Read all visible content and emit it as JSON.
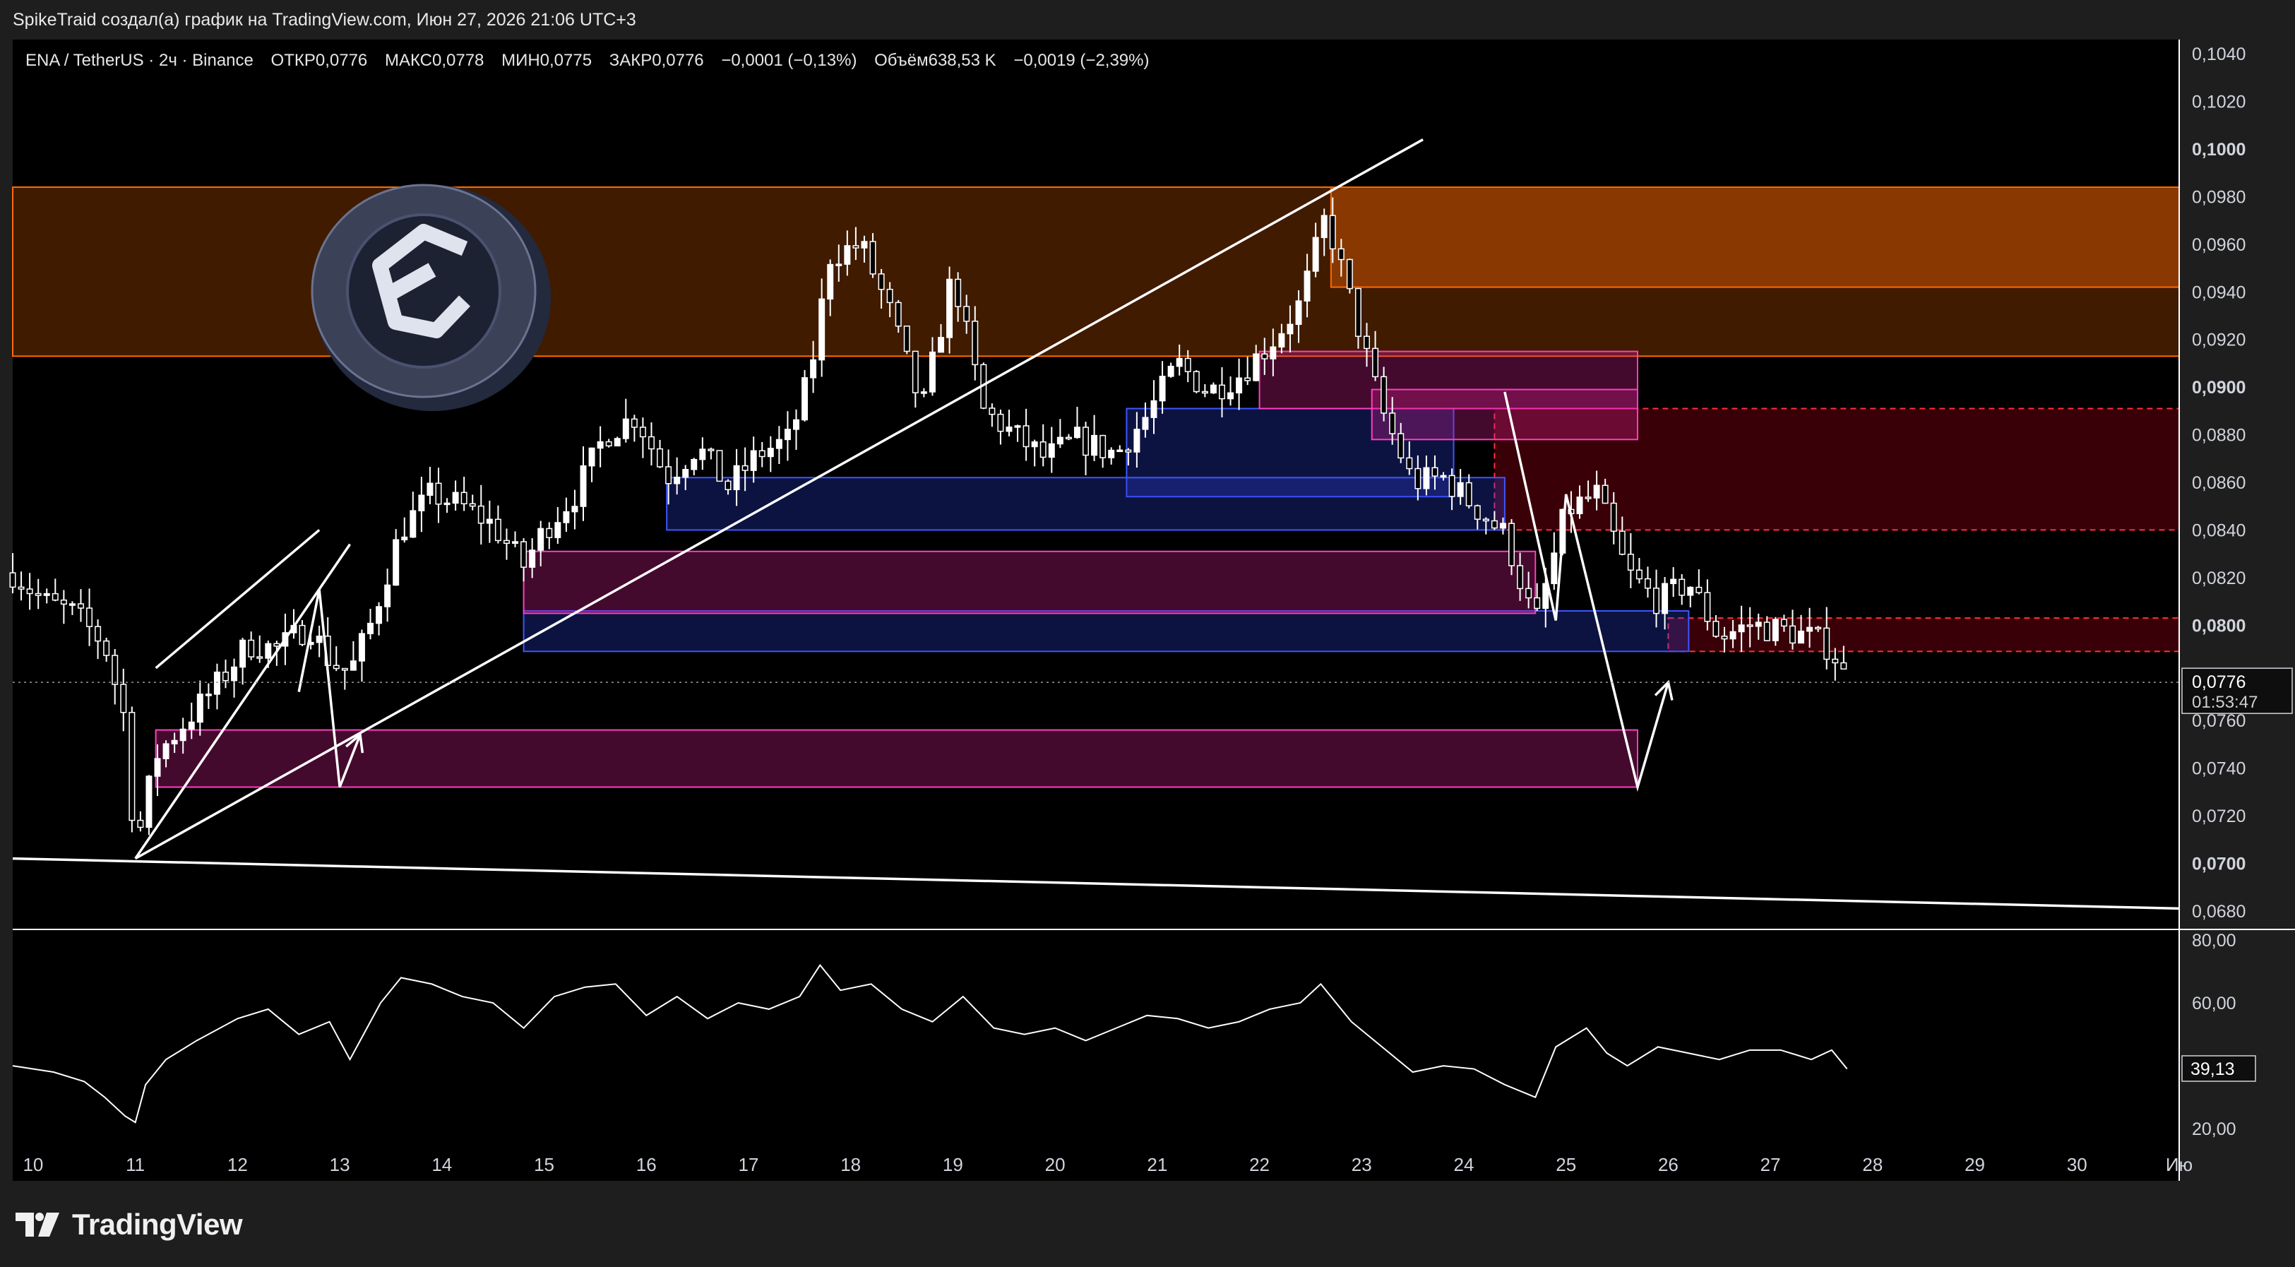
{
  "header": {
    "attribution": "SpikeTraid создал(а) график на TradingView.com, Июн 27, 2026 21:06 UTC+3"
  },
  "legend": {
    "symbol": "ENA / TetherUS · 2ч · Binance",
    "open": "ОТКР0,0776",
    "high": "МАКС0,0778",
    "low": "МИН0,0775",
    "close": "ЗАКР0,0776",
    "change": "−0,0001 (−0,13%)",
    "volume": "Объём638,53 K",
    "change2": "−0,0019 (−2,39%)"
  },
  "price_axis": {
    "labels": [
      "0,1040",
      "0,1020",
      "0,1000",
      "0,0980",
      "0,0960",
      "0,0940",
      "0,0920",
      "0,0900",
      "0,0880",
      "0,0860",
      "0,0840",
      "0,0820",
      "0,0800",
      "0,0780",
      "0,0760",
      "0,0740",
      "0,0720",
      "0,0700",
      "0,0680"
    ],
    "bold_labels": [
      "0,1000",
      "0,0900",
      "0,0800",
      "0,0700"
    ],
    "current_price": "0,0776",
    "countdown": "01:53:47"
  },
  "time_axis": {
    "labels": [
      "10",
      "11",
      "12",
      "13",
      "14",
      "15",
      "16",
      "17",
      "18",
      "19",
      "20",
      "21",
      "22",
      "23",
      "24",
      "25",
      "26",
      "27",
      "28",
      "29",
      "30",
      "Ию"
    ]
  },
  "indicator_axis": {
    "labels": [
      "80,00",
      "60,00",
      "20,00"
    ],
    "current_value": "39,13"
  },
  "footer": {
    "brand": "TradingView"
  },
  "colors": {
    "up_candle": "#ffffff",
    "down_candle": "#000000",
    "supply_zone": "#ff6a00",
    "demand_zone": "#2b3fd6",
    "magenta_zone": "#d21e8c",
    "red_zone": "#c0001a",
    "trendline": "#ffffff"
  },
  "chart_data": {
    "type": "candlestick",
    "symbol": "ENA / TetherUS",
    "interval": "2ч",
    "exchange": "Binance",
    "ylim": [
      0.0674,
      0.1046
    ],
    "x_range_days": [
      9.8,
      31.0
    ],
    "close_path": [
      [
        9.8,
        0.0822
      ],
      [
        10.1,
        0.081
      ],
      [
        10.4,
        0.0805
      ],
      [
        10.7,
        0.0792
      ],
      [
        10.9,
        0.076
      ],
      [
        11.0,
        0.0705
      ],
      [
        11.2,
        0.0745
      ],
      [
        11.5,
        0.076
      ],
      [
        11.8,
        0.0775
      ],
      [
        12.1,
        0.0792
      ],
      [
        12.4,
        0.079
      ],
      [
        12.7,
        0.08
      ],
      [
        12.9,
        0.0785
      ],
      [
        13.1,
        0.078
      ],
      [
        13.3,
        0.08
      ],
      [
        13.6,
        0.084
      ],
      [
        13.9,
        0.0855
      ],
      [
        14.2,
        0.085
      ],
      [
        14.5,
        0.0842
      ],
      [
        14.8,
        0.0825
      ],
      [
        15.0,
        0.084
      ],
      [
        15.3,
        0.0855
      ],
      [
        15.6,
        0.088
      ],
      [
        15.9,
        0.0888
      ],
      [
        16.2,
        0.0862
      ],
      [
        16.5,
        0.0875
      ],
      [
        16.8,
        0.0858
      ],
      [
        17.1,
        0.0872
      ],
      [
        17.4,
        0.0878
      ],
      [
        17.6,
        0.0905
      ],
      [
        17.8,
        0.0955
      ],
      [
        18.1,
        0.096
      ],
      [
        18.4,
        0.093
      ],
      [
        18.7,
        0.089
      ],
      [
        19.0,
        0.0948
      ],
      [
        19.3,
        0.089
      ],
      [
        19.6,
        0.088
      ],
      [
        19.9,
        0.087
      ],
      [
        20.2,
        0.0878
      ],
      [
        20.6,
        0.0872
      ],
      [
        20.9,
        0.0888
      ],
      [
        21.2,
        0.091
      ],
      [
        21.5,
        0.0898
      ],
      [
        21.8,
        0.0905
      ],
      [
        22.1,
        0.0918
      ],
      [
        22.4,
        0.0935
      ],
      [
        22.65,
        0.0972
      ],
      [
        22.9,
        0.0935
      ],
      [
        23.2,
        0.089
      ],
      [
        23.5,
        0.086
      ],
      [
        23.8,
        0.0862
      ],
      [
        24.1,
        0.085
      ],
      [
        24.4,
        0.0838
      ],
      [
        24.7,
        0.08
      ],
      [
        25.0,
        0.0848
      ],
      [
        25.3,
        0.0855
      ],
      [
        25.6,
        0.0822
      ],
      [
        25.9,
        0.081
      ],
      [
        26.2,
        0.0818
      ],
      [
        26.5,
        0.0795
      ],
      [
        26.8,
        0.08
      ],
      [
        27.1,
        0.0798
      ],
      [
        27.4,
        0.0795
      ],
      [
        27.6,
        0.079
      ],
      [
        27.75,
        0.0776
      ]
    ],
    "current_price": 0.0776,
    "zones": [
      {
        "kind": "supply",
        "x1": 9.8,
        "x2": 31.0,
        "y1": 0.0913,
        "y2": 0.0984
      },
      {
        "kind": "supply_strong",
        "x1": 22.7,
        "x2": 31.0,
        "y1": 0.0942,
        "y2": 0.0984
      },
      {
        "kind": "red",
        "x1": 24.3,
        "x2": 31.0,
        "y1": 0.084,
        "y2": 0.0891
      },
      {
        "kind": "red",
        "x1": 26.0,
        "x2": 31.0,
        "y1": 0.0789,
        "y2": 0.0803
      },
      {
        "kind": "demand",
        "x1": 20.7,
        "x2": 23.9,
        "y1": 0.0854,
        "y2": 0.0891
      },
      {
        "kind": "demand",
        "x1": 16.2,
        "x2": 24.4,
        "y1": 0.084,
        "y2": 0.0862
      },
      {
        "kind": "demand",
        "x1": 14.8,
        "x2": 26.2,
        "y1": 0.0789,
        "y2": 0.0806
      },
      {
        "kind": "magenta",
        "x1": 22.0,
        "x2": 25.7,
        "y1": 0.0891,
        "y2": 0.0915
      },
      {
        "kind": "magenta",
        "x1": 23.1,
        "x2": 25.7,
        "y1": 0.0878,
        "y2": 0.0899
      },
      {
        "kind": "magenta",
        "x1": 14.8,
        "x2": 24.7,
        "y1": 0.0805,
        "y2": 0.0831
      },
      {
        "kind": "magenta",
        "x1": 11.2,
        "x2": 25.7,
        "y1": 0.0732,
        "y2": 0.0756
      }
    ],
    "trendlines": [
      {
        "x1": 11.0,
        "y1": 0.0702,
        "x2": 23.6,
        "y2": 0.1004
      },
      {
        "x1": 9.8,
        "y1": 0.0702,
        "x2": 31.0,
        "y2": 0.0681
      },
      {
        "x1": 11.2,
        "y1": 0.0782,
        "x2": 12.8,
        "y2": 0.084
      },
      {
        "x1": 11.0,
        "y1": 0.0702,
        "x2": 13.1,
        "y2": 0.0834
      }
    ],
    "projections": [
      [
        [
          12.6,
          0.0772
        ],
        [
          12.8,
          0.0815
        ],
        [
          13.0,
          0.0732
        ],
        [
          13.2,
          0.0754
        ]
      ],
      [
        [
          24.4,
          0.0898
        ],
        [
          24.9,
          0.0802
        ],
        [
          25.0,
          0.0855
        ],
        [
          25.7,
          0.0732
        ],
        [
          26.0,
          0.0776
        ]
      ]
    ],
    "indicator": {
      "ylim": [
        16,
        82
      ],
      "labels": [
        "80,00",
        "60,00",
        "20,00"
      ],
      "current": 39.13,
      "points": [
        [
          9.8,
          40
        ],
        [
          10.2,
          38
        ],
        [
          10.5,
          35
        ],
        [
          10.7,
          30
        ],
        [
          10.9,
          24
        ],
        [
          11.0,
          22
        ],
        [
          11.1,
          34
        ],
        [
          11.3,
          42
        ],
        [
          11.6,
          48
        ],
        [
          12.0,
          55
        ],
        [
          12.3,
          58
        ],
        [
          12.6,
          50
        ],
        [
          12.9,
          54
        ],
        [
          13.1,
          42
        ],
        [
          13.4,
          60
        ],
        [
          13.6,
          68
        ],
        [
          13.9,
          66
        ],
        [
          14.2,
          62
        ],
        [
          14.5,
          60
        ],
        [
          14.8,
          52
        ],
        [
          15.1,
          62
        ],
        [
          15.4,
          65
        ],
        [
          15.7,
          66
        ],
        [
          16.0,
          56
        ],
        [
          16.3,
          62
        ],
        [
          16.6,
          55
        ],
        [
          16.9,
          60
        ],
        [
          17.2,
          58
        ],
        [
          17.5,
          62
        ],
        [
          17.7,
          72
        ],
        [
          17.9,
          64
        ],
        [
          18.2,
          66
        ],
        [
          18.5,
          58
        ],
        [
          18.8,
          54
        ],
        [
          19.1,
          62
        ],
        [
          19.4,
          52
        ],
        [
          19.7,
          50
        ],
        [
          20.0,
          52
        ],
        [
          20.3,
          48
        ],
        [
          20.6,
          52
        ],
        [
          20.9,
          56
        ],
        [
          21.2,
          55
        ],
        [
          21.5,
          52
        ],
        [
          21.8,
          54
        ],
        [
          22.1,
          58
        ],
        [
          22.4,
          60
        ],
        [
          22.6,
          66
        ],
        [
          22.9,
          54
        ],
        [
          23.2,
          46
        ],
        [
          23.5,
          38
        ],
        [
          23.8,
          40
        ],
        [
          24.1,
          39
        ],
        [
          24.4,
          34
        ],
        [
          24.7,
          30
        ],
        [
          24.9,
          46
        ],
        [
          25.2,
          52
        ],
        [
          25.4,
          44
        ],
        [
          25.6,
          40
        ],
        [
          25.9,
          46
        ],
        [
          26.2,
          44
        ],
        [
          26.5,
          42
        ],
        [
          26.8,
          45
        ],
        [
          27.1,
          45
        ],
        [
          27.4,
          42
        ],
        [
          27.6,
          45
        ],
        [
          27.75,
          39
        ]
      ]
    }
  }
}
